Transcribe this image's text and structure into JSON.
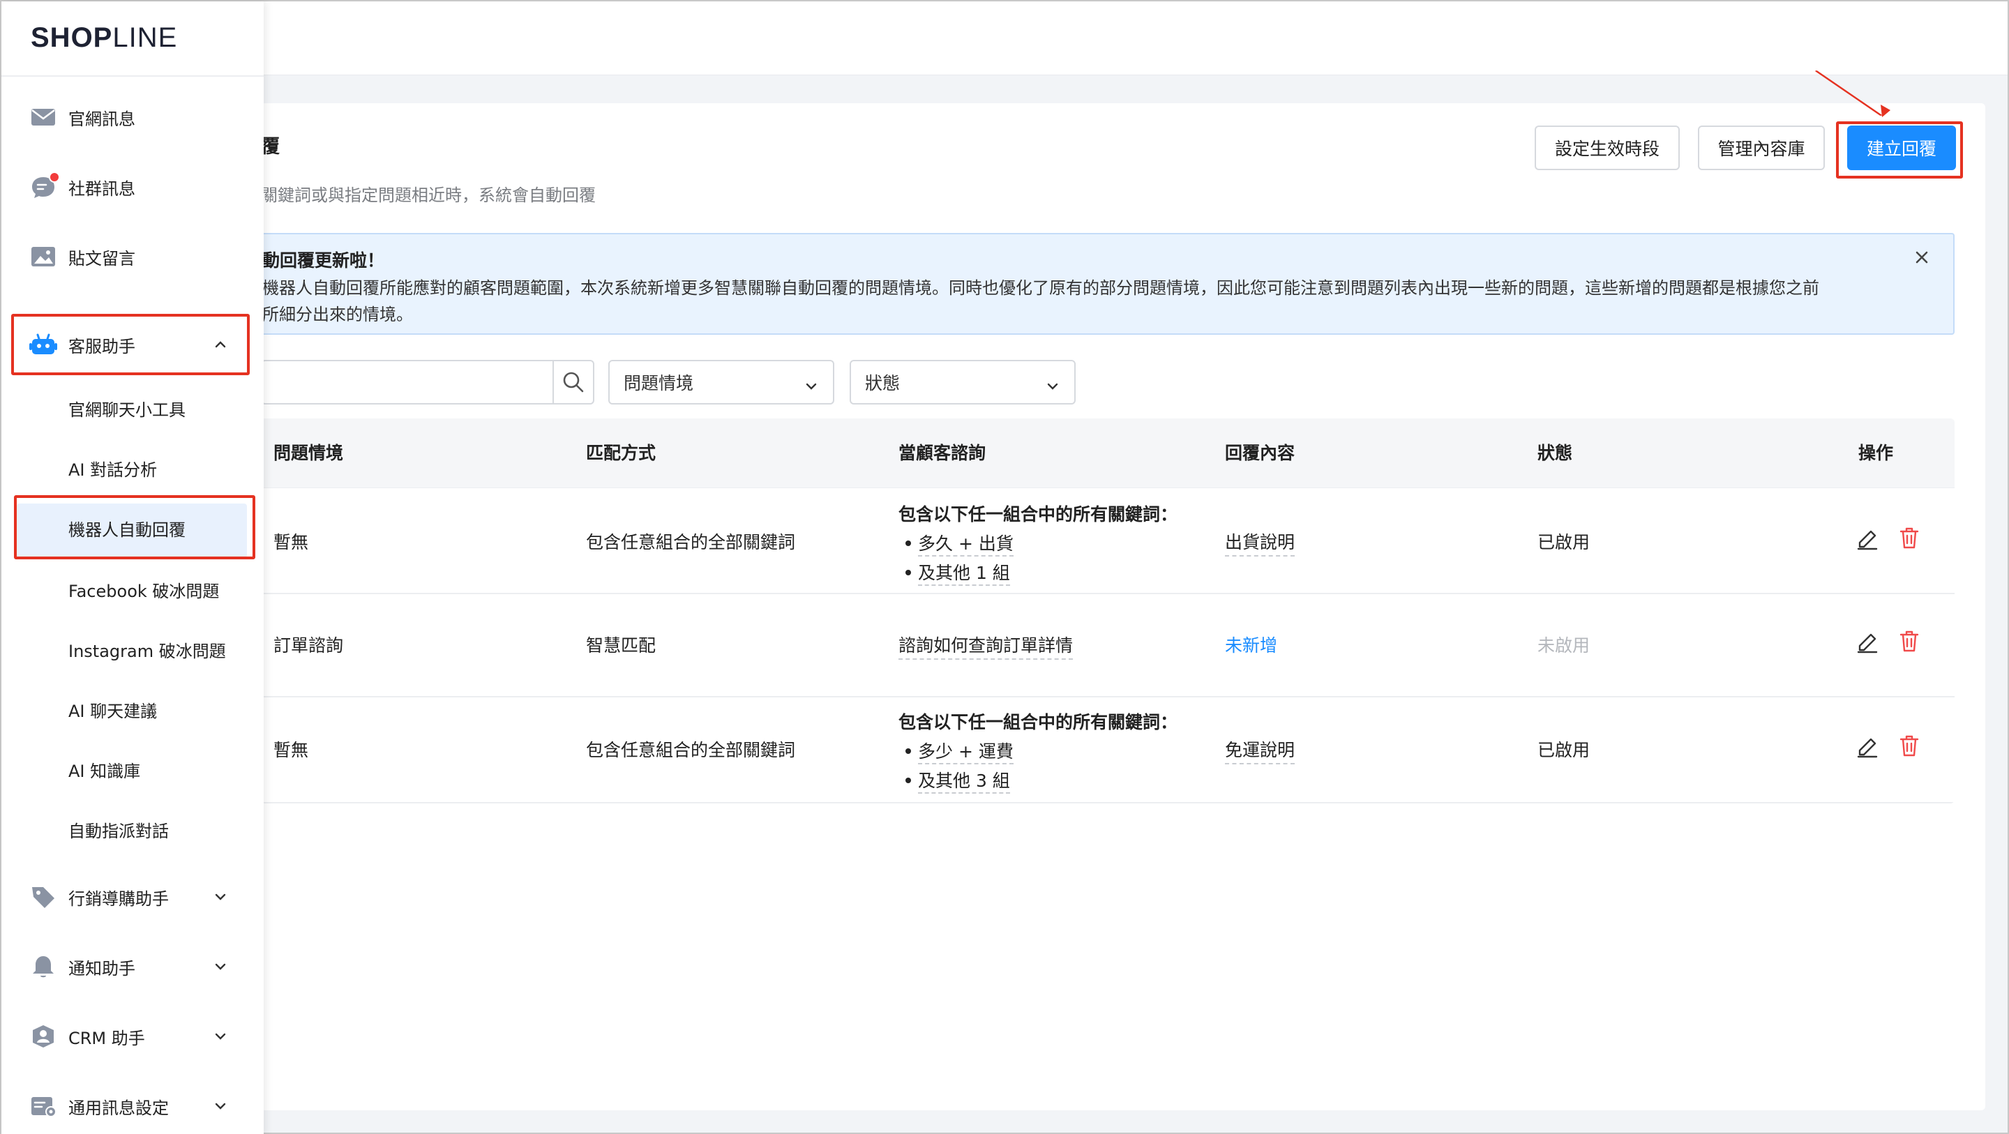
{
  "brand": {
    "logo_bold": "SHOP",
    "logo_o": "O",
    "logo_light": "LINE"
  },
  "sidebar": {
    "items": [
      {
        "label": "官網訊息",
        "icon": "mail-icon"
      },
      {
        "label": "社群訊息",
        "icon": "chat-bubble-icon",
        "badge": "red-dot"
      },
      {
        "label": "貼文留言",
        "icon": "image-icon"
      },
      {
        "label": "客服助手",
        "icon": "robot-icon",
        "expanded": true
      },
      {
        "label": "行銷導購助手",
        "icon": "tag-icon"
      },
      {
        "label": "通知助手",
        "icon": "bell-icon"
      },
      {
        "label": "CRM 助手",
        "icon": "user-group-icon"
      },
      {
        "label": "通用訊息設定",
        "icon": "settings-card-icon"
      }
    ],
    "subitems": [
      {
        "label": "官網聊天小工具"
      },
      {
        "label": "AI 對話分析"
      },
      {
        "label": "機器人自動回覆",
        "active": true
      },
      {
        "label": "Facebook 破冰問題"
      },
      {
        "label": "Instagram 破冰問題"
      },
      {
        "label": "AI 聊天建議"
      },
      {
        "label": "AI 知識庫"
      },
      {
        "label": "自動指派對話"
      }
    ]
  },
  "header": {
    "title": "覆",
    "subtitle": "關鍵詞或與指定問題相近時，系統會自動回覆",
    "buttons": {
      "schedule": "設定生效時段",
      "library": "管理內容庫",
      "create": "建立回覆"
    }
  },
  "notice": {
    "title": "動回覆更新啦！",
    "line1": "機器人自動回覆所能應對的顧客問題範圍，本次系統新增更多智慧關聯自動回覆的問題情境。同時也優化了原有的部分問題情境，因此您可能注意到問題列表內出現一些新的問題，這些新增的問題都是根據您之前",
    "line2": "所細分出來的情境。"
  },
  "filters": {
    "search_placeholder": "",
    "scenario": "問題情境",
    "status": "狀態"
  },
  "table": {
    "headers": [
      "問題情境",
      "匹配方式",
      "當顧客諮詢",
      "回覆內容",
      "狀態",
      "操作"
    ],
    "rows": [
      {
        "scenario": "暫無",
        "match": "包含任意組合的全部關鍵詞",
        "query_title": "包含以下任一組合中的所有關鍵詞：",
        "query_items": [
          "多久 + 出貨",
          "及其他 1 組"
        ],
        "reply": "出貨說明",
        "status": "已啟用"
      },
      {
        "scenario": "訂單諮詢",
        "match": "智慧匹配",
        "query_text": "諮詢如何查詢訂單詳情",
        "reply": "未新增",
        "status": "未啟用"
      },
      {
        "scenario": "暫無",
        "match": "包含任意組合的全部關鍵詞",
        "query_title": "包含以下任一組合中的所有關鍵詞：",
        "query_items": [
          "多少 + 運費",
          "及其他 3 組"
        ],
        "reply": "免運說明",
        "status": "已啟用"
      }
    ]
  },
  "colors": {
    "primary": "#1a8cff",
    "highlight": "#e53221",
    "delete": "#f04a4a",
    "notice_bg": "#e9f3fe"
  }
}
